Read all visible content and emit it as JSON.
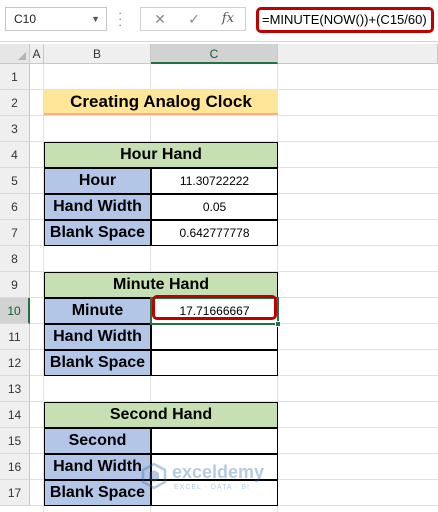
{
  "formula_bar": {
    "name_box": "C10",
    "cancel_icon": "✕",
    "enter_icon": "✓",
    "fx_label": "fx",
    "formula": "=MINUTE(NOW())+(C15/60)"
  },
  "columns": [
    "A",
    "B",
    "C"
  ],
  "selected_column": "C",
  "rows": [
    "1",
    "2",
    "3",
    "4",
    "5",
    "6",
    "7",
    "8",
    "9",
    "10",
    "11",
    "12",
    "13",
    "14",
    "15",
    "16",
    "17"
  ],
  "selected_row": "10",
  "sheet": {
    "title": "Creating Analog Clock",
    "hour_table": {
      "header": "Hour Hand",
      "rows": [
        {
          "label": "Hour",
          "value": "11.30722222"
        },
        {
          "label": "Hand Width",
          "value": "0.05"
        },
        {
          "label": "Blank Space",
          "value": "0.642777778"
        }
      ]
    },
    "minute_table": {
      "header": "Minute Hand",
      "rows": [
        {
          "label": "Minute",
          "value": "17.71666667"
        },
        {
          "label": "Hand Width",
          "value": ""
        },
        {
          "label": "Blank Space",
          "value": ""
        }
      ]
    },
    "second_table": {
      "header": "Second Hand",
      "rows": [
        {
          "label": "Second",
          "value": ""
        },
        {
          "label": "Hand Width",
          "value": ""
        },
        {
          "label": "Blank Space",
          "value": ""
        }
      ]
    }
  },
  "watermark": {
    "name": "exceldemy",
    "tagline": "EXCEL · DATA · BI"
  },
  "colors": {
    "title_fill": "#ffe699",
    "header_fill": "#c6e0b4",
    "label_fill": "#b4c6e7",
    "highlight_red": "#c00000",
    "selection_green": "#217346"
  }
}
